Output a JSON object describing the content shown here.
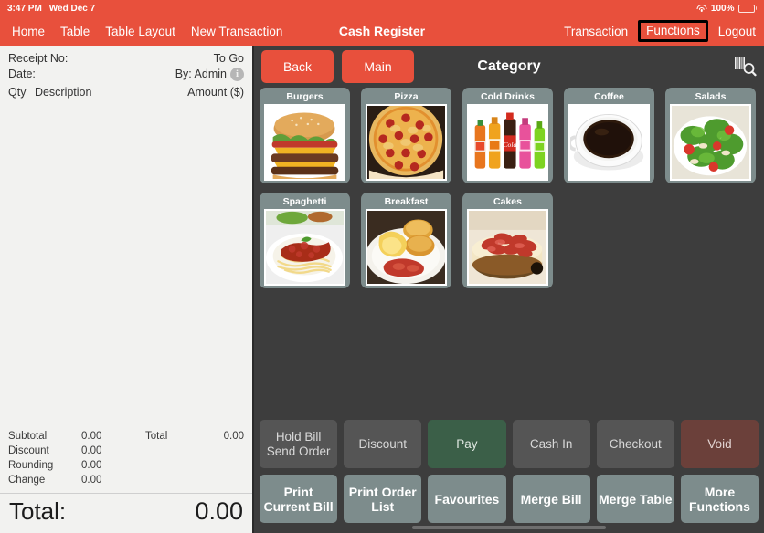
{
  "statusbar": {
    "time": "3:47 PM",
    "date": "Wed Dec 7",
    "battery_percent": "100%",
    "wifi_icon": "wifi-icon",
    "battery_icon": "battery-icon"
  },
  "navbar": {
    "title": "Cash Register",
    "left_items": [
      {
        "label": "Home",
        "name": "nav-home"
      },
      {
        "label": "Table",
        "name": "nav-table"
      },
      {
        "label": "Table Layout",
        "name": "nav-table-layout"
      },
      {
        "label": "New Transaction",
        "name": "nav-new-transaction"
      }
    ],
    "right_items": [
      {
        "label": "Transaction",
        "name": "nav-transaction",
        "highlighted": false
      },
      {
        "label": "Functions",
        "name": "nav-functions",
        "highlighted": true
      },
      {
        "label": "Logout",
        "name": "nav-logout",
        "highlighted": false
      }
    ]
  },
  "receipt": {
    "receipt_no_label": "Receipt No:",
    "receipt_no_value": "",
    "order_type": "To Go",
    "date_label": "Date:",
    "date_value": "",
    "by_label": "By: Admin",
    "info_icon": "info-icon",
    "col_qty": "Qty",
    "col_description": "Description",
    "col_amount": "Amount ($)",
    "items": [],
    "totals": [
      {
        "label": "Subtotal",
        "value": "0.00"
      },
      {
        "label": "Discount",
        "value": "0.00"
      },
      {
        "label": "Rounding",
        "value": "0.00"
      },
      {
        "label": "Change",
        "value": "0.00"
      }
    ],
    "side_total_label": "Total",
    "side_total_value": "0.00",
    "grand_total_label": "Total:",
    "grand_total_value": "0.00"
  },
  "category_bar": {
    "back_label": "Back",
    "main_label": "Main",
    "title": "Category",
    "scan_icon": "barcode-search-icon"
  },
  "categories": [
    {
      "label": "Burgers",
      "image": "burger-photo"
    },
    {
      "label": "Pizza",
      "image": "pizza-photo"
    },
    {
      "label": "Cold Drinks",
      "image": "cold-drinks-photo"
    },
    {
      "label": "Coffee",
      "image": "coffee-photo"
    },
    {
      "label": "Salads",
      "image": "salad-photo"
    },
    {
      "label": "Spaghetti",
      "image": "spaghetti-photo"
    },
    {
      "label": "Breakfast",
      "image": "breakfast-photo"
    },
    {
      "label": "Cakes",
      "image": "cake-photo"
    }
  ],
  "actions": {
    "row1": [
      {
        "label": "Hold Bill\nSend Order",
        "name": "hold-bill-send-order-button",
        "style": "default"
      },
      {
        "label": "Discount",
        "name": "discount-button",
        "style": "default"
      },
      {
        "label": "Pay",
        "name": "pay-button",
        "style": "green"
      },
      {
        "label": "Cash In",
        "name": "cash-in-button",
        "style": "default"
      },
      {
        "label": "Checkout",
        "name": "checkout-button",
        "style": "default"
      },
      {
        "label": "Void",
        "name": "void-button",
        "style": "voidred"
      }
    ],
    "row2": [
      {
        "label": "Print\nCurrent Bill",
        "name": "print-current-bill-button",
        "style": "slate"
      },
      {
        "label": "Print Order\nList",
        "name": "print-order-list-button",
        "style": "slate"
      },
      {
        "label": "Favourites",
        "name": "favourites-button",
        "style": "slate"
      },
      {
        "label": "Merge Bill",
        "name": "merge-bill-button",
        "style": "slate"
      },
      {
        "label": "Merge Table",
        "name": "merge-table-button",
        "style": "slate"
      },
      {
        "label": "More\nFunctions",
        "name": "more-functions-button",
        "style": "slate"
      }
    ]
  },
  "colors": {
    "brand_red": "#e8503c",
    "dark_bg": "#3d3d3d",
    "slate": "#7d8c8c",
    "pay_green": "#3b5f48",
    "void_red": "#6b403a",
    "receipt_bg": "#f2f2f0",
    "highlight_outline": "#000000"
  }
}
